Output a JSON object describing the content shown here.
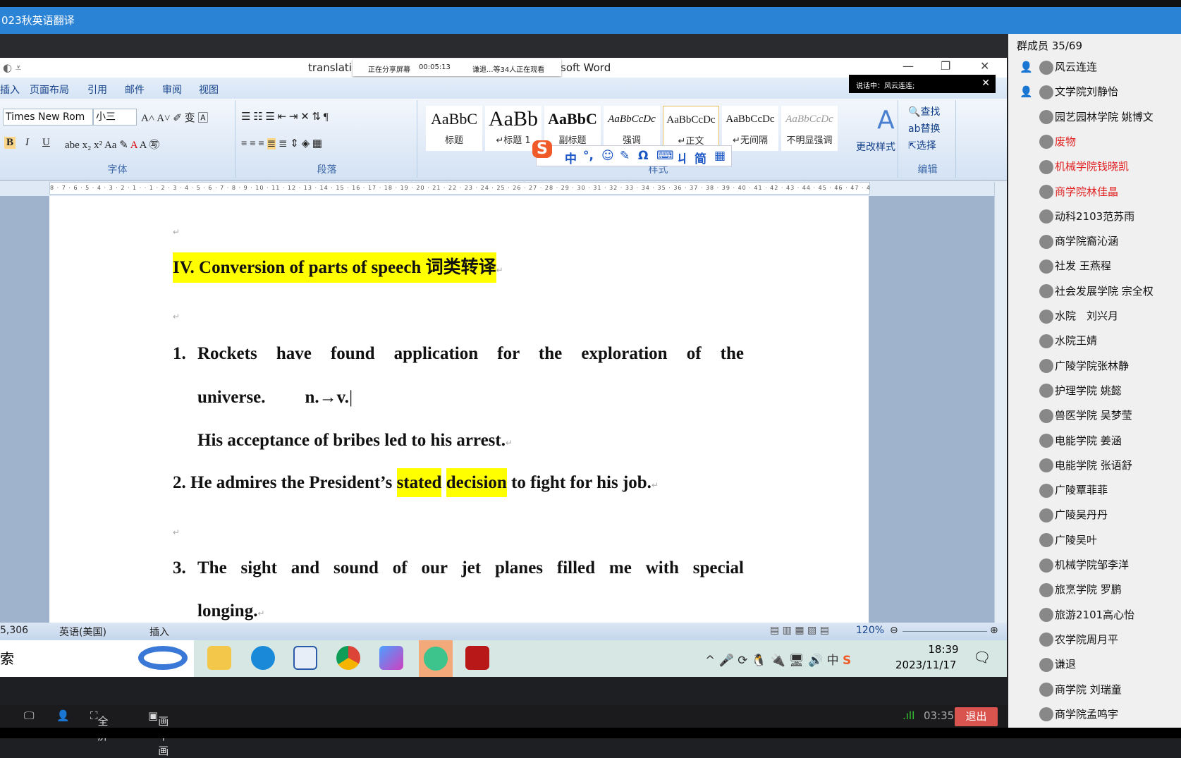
{
  "window_title": "023秋英语翻译",
  "word": {
    "title_left": "translatio",
    "title_right": "soft Word",
    "share_bar": {
      "status": "正在分享屏幕",
      "elapsed": "00:05:13",
      "viewers": "谦退...等34人正在观看"
    },
    "speaking": "说话中：风云连连;",
    "tabs": [
      "插入",
      "页面布局",
      "引用",
      "邮件",
      "审阅",
      "视图"
    ],
    "font": {
      "name": "Times New Rom",
      "size": "小三",
      "group_label": "字体"
    },
    "paragraph_label": "段落",
    "styles": [
      {
        "sample": "AaBbC",
        "name": "标题"
      },
      {
        "sample": "AaBb",
        "name": "↵标题 1"
      },
      {
        "sample": "AaBbC",
        "name": "副标题"
      },
      {
        "sample": "AaBbCcDc",
        "name": "强调"
      },
      {
        "sample": "AaBbCcDc",
        "name": "↵正文"
      },
      {
        "sample": "AaBbCcDc",
        "name": "↵无间隔"
      },
      {
        "sample": "AaBbCcDc",
        "name": "不明显强调"
      }
    ],
    "change_styles": "更改样式",
    "styles_label": "样式",
    "edit": {
      "find": "查找",
      "replace": "替换",
      "select": "选择",
      "label": "编辑"
    },
    "ime": [
      "中",
      "°,",
      "☺",
      "✎",
      "Ω",
      "⌨",
      "ㄐ",
      "简",
      "▦"
    ],
    "ruler": "8 · 7 · 6 · 5 · 4 · 3 · 2 · 1 · · 1 · 2 · 3 · 4 · 5 · 6 · 7 · 8 · 9 · 10 · 11 · 12 · 13 · 14 · 15 · 16 · 17 · 18 · 19 · 20 · 21 · 22 · 23 · 24 · 25 · 26 · 27 · 28 · 29 · 30 · 31 · 32 · 33 · 34 · 35 · 36 · 37 · 38 · 39 · 40 · 41 · 42 · 43 · 44 · 45 · 46 · 47 · 48",
    "doc": {
      "heading": "IV. Conversion of parts of speech 词类转译",
      "l1_num": "1.",
      "l1": "Rockets have found application for the exploration of the",
      "l1b": "universe.",
      "l1c": "n.→v.",
      "l1d": "His acceptance of bribes led to his arrest.",
      "l2_num": "2.",
      "l2a": "He admires the President’s ",
      "l2b": "stated",
      "l2c": "decision",
      "l2d": " to fight for his job.",
      "l3_num": "3.",
      "l3": "The sight and sound of our jet planes filled me with special",
      "l3b": "longing.",
      "para_mark": "↵"
    },
    "status": {
      "words": "5,306",
      "language": "英语(美国)",
      "mode": "插入",
      "zoom": "120%"
    },
    "taskbar": {
      "search": "索",
      "time": "18:39",
      "date": "2023/11/17",
      "ime": "中"
    }
  },
  "members": {
    "header": "群成员 35/69",
    "list": [
      {
        "name": "风云连连",
        "red": false
      },
      {
        "name": "文学院刘静怡",
        "red": false
      },
      {
        "name": "园艺园林学院 姚博文",
        "red": false
      },
      {
        "name": "废物",
        "red": true
      },
      {
        "name": "机械学院钱晓凯",
        "red": true
      },
      {
        "name": "商学院林佳晶",
        "red": true
      },
      {
        "name": "动科2103范苏雨",
        "red": false
      },
      {
        "name": "商学院裔沁涵",
        "red": false
      },
      {
        "name": "社发 王燕程",
        "red": false
      },
      {
        "name": "社会发展学院 宗全权",
        "red": false
      },
      {
        "name": "水院　刘兴月",
        "red": false
      },
      {
        "name": "水院王婧",
        "red": false
      },
      {
        "name": "广陵学院张林静",
        "red": false
      },
      {
        "name": "护理学院 姚懿",
        "red": false
      },
      {
        "name": "兽医学院 吴梦莹",
        "red": false
      },
      {
        "name": "电能学院 姜涵",
        "red": false
      },
      {
        "name": "电能学院 张语舒",
        "red": false
      },
      {
        "name": "广陵覃菲菲",
        "red": false
      },
      {
        "name": "广陵吴丹丹",
        "red": false
      },
      {
        "name": "广陵吴叶",
        "red": false
      },
      {
        "name": "机械学院邹李洋",
        "red": false
      },
      {
        "name": "旅烹学院 罗鹏",
        "red": false
      },
      {
        "name": "旅游2101高心怡",
        "red": false
      },
      {
        "name": "农学院周月平",
        "red": false
      },
      {
        "name": "谦退",
        "red": false
      },
      {
        "name": "商学院 刘瑞童",
        "red": false
      },
      {
        "name": "商学院孟鸣宇",
        "red": false
      }
    ]
  },
  "bottombar": {
    "fullscreen": "全屏",
    "pip": "画中画",
    "duration": "03:35",
    "exit": "退出"
  },
  "colors": {
    "accent": "#2b83d6",
    "highlight": "#ffff00",
    "exit": "#d9534f",
    "member_red": "#e02020"
  }
}
